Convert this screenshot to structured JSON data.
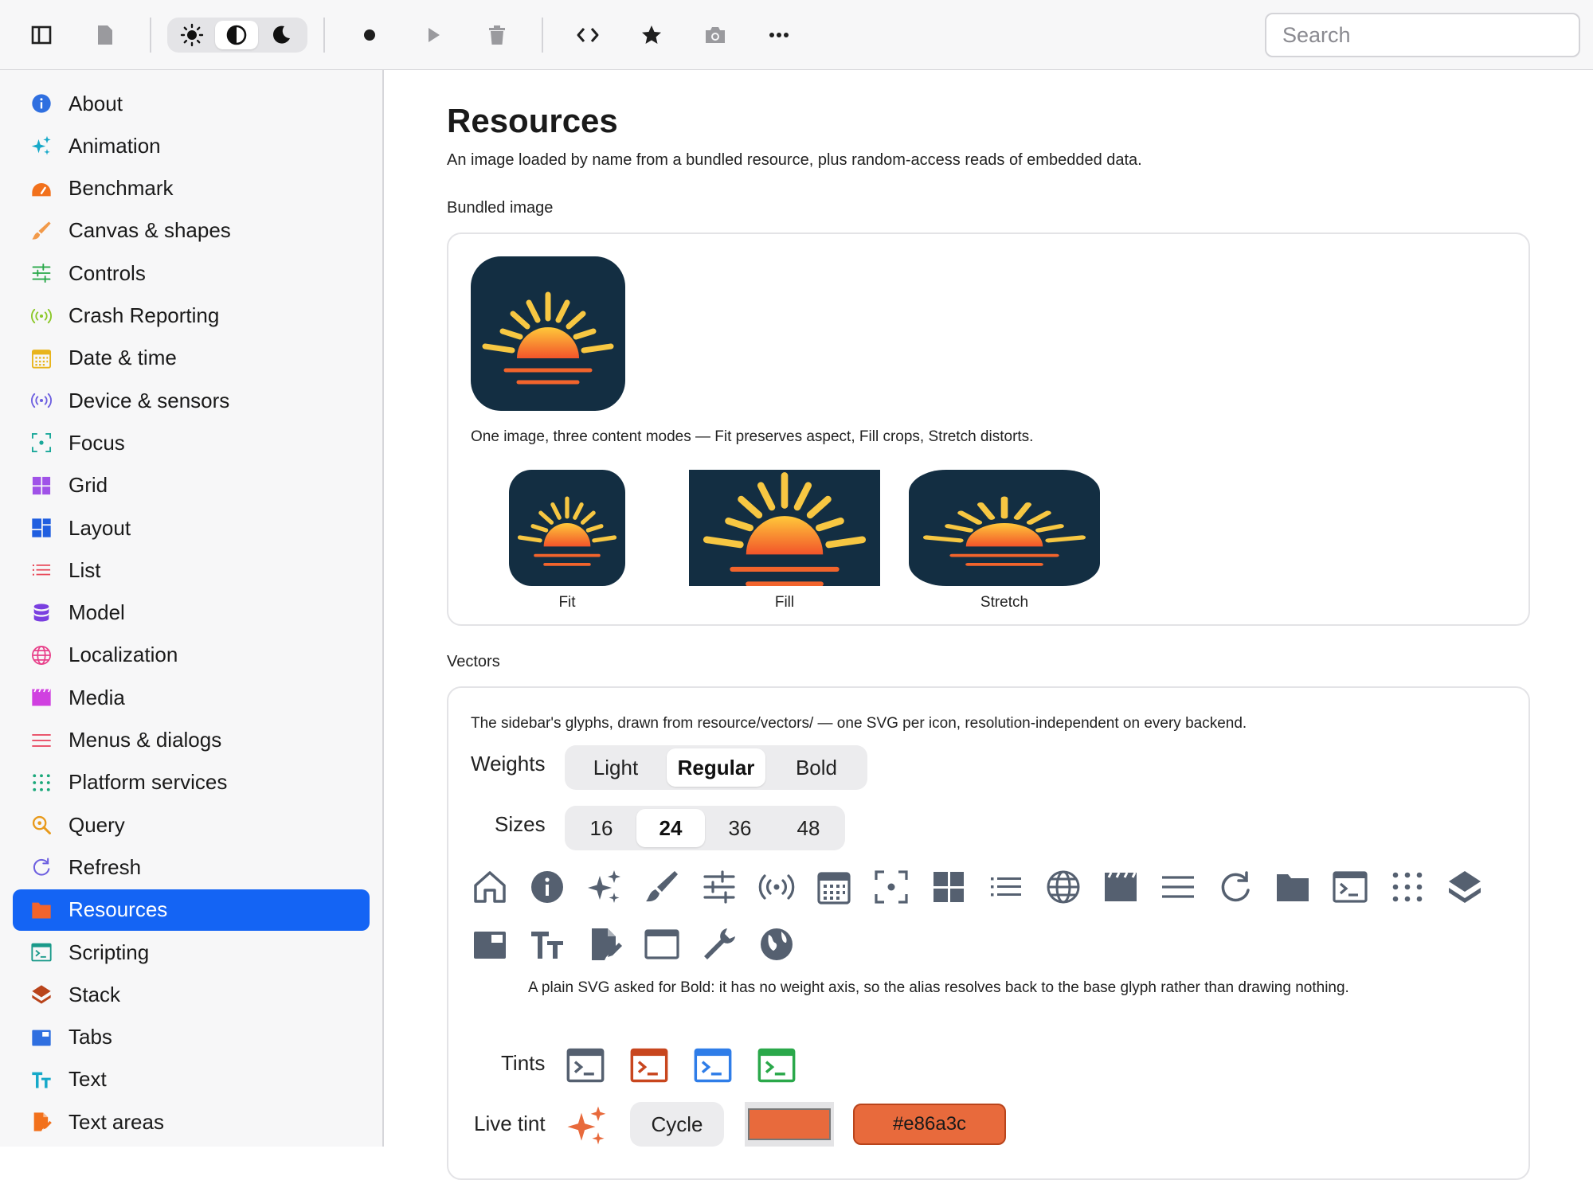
{
  "toolbar": {
    "search_placeholder": "Search",
    "icons": [
      "sidebar-toggle-icon",
      "document-icon",
      "sun-icon",
      "contrast-icon",
      "moon-icon",
      "record-icon",
      "play-icon",
      "trash-icon",
      "code-icon",
      "star-icon",
      "camera-icon",
      "more-icon"
    ]
  },
  "sidebar": {
    "items": [
      {
        "label": "About",
        "icon": "info-icon",
        "color": "#2f6fe0"
      },
      {
        "label": "Animation",
        "icon": "sparkles-icon",
        "color": "#16a9c9"
      },
      {
        "label": "Benchmark",
        "icon": "gauge-icon",
        "color": "#f2711c"
      },
      {
        "label": "Canvas & shapes",
        "icon": "brush-icon",
        "color": "#f29a4a"
      },
      {
        "label": "Controls",
        "icon": "sliders-icon",
        "color": "#2aa84a"
      },
      {
        "label": "Crash Reporting",
        "icon": "broadcast-icon",
        "color": "#8cc82a"
      },
      {
        "label": "Date & time",
        "icon": "calendar-icon",
        "color": "#e8b41c"
      },
      {
        "label": "Device & sensors",
        "icon": "sensor-icon",
        "color": "#6d5fe0"
      },
      {
        "label": "Focus",
        "icon": "focus-icon",
        "color": "#1aa89a"
      },
      {
        "label": "Grid",
        "icon": "grid-icon",
        "color": "#a052e8"
      },
      {
        "label": "Layout",
        "icon": "layout-icon",
        "color": "#1f5ee0"
      },
      {
        "label": "List",
        "icon": "list-icon",
        "color": "#e84a5a"
      },
      {
        "label": "Model",
        "icon": "database-icon",
        "color": "#7a3fe0"
      },
      {
        "label": "Localization",
        "icon": "globe-icon",
        "color": "#e8408a"
      },
      {
        "label": "Media",
        "icon": "clapper-icon",
        "color": "#d040e0"
      },
      {
        "label": "Menus & dialogs",
        "icon": "menu-icon",
        "color": "#e8405a"
      },
      {
        "label": "Platform services",
        "icon": "dots-grid-icon",
        "color": "#1aa87a"
      },
      {
        "label": "Query",
        "icon": "search-icon",
        "color": "#e89a1c"
      },
      {
        "label": "Refresh",
        "icon": "refresh-icon",
        "color": "#6d5fe0"
      },
      {
        "label": "Resources",
        "icon": "folder-icon",
        "color": "#f2642c",
        "active": true
      },
      {
        "label": "Scripting",
        "icon": "terminal-icon",
        "color": "#1a9a8a"
      },
      {
        "label": "Stack",
        "icon": "layers-icon",
        "color": "#b9441b"
      },
      {
        "label": "Tabs",
        "icon": "tabs-icon",
        "color": "#2f6fe0"
      },
      {
        "label": "Text",
        "icon": "text-icon",
        "color": "#16a9c9"
      },
      {
        "label": "Text areas",
        "icon": "document-edit-icon",
        "color": "#f2711c"
      }
    ]
  },
  "main": {
    "title": "Resources",
    "subtitle": "An image loaded by name from a bundled resource, plus random-access reads of embedded data.",
    "bundled": {
      "heading": "Bundled image",
      "caption": "One image, three content modes — Fit preserves aspect, Fill crops, Stretch distorts.",
      "modes": [
        "Fit",
        "Fill",
        "Stretch"
      ]
    },
    "vectors": {
      "heading": "Vectors",
      "caption": "The sidebar's glyphs, drawn from resource/vectors/ — one SVG per icon, resolution-independent on every backend.",
      "weights_label": "Weights",
      "weights": [
        "Light",
        "Regular",
        "Bold"
      ],
      "weight_selected": "Regular",
      "sizes_label": "Sizes",
      "sizes": [
        "16",
        "24",
        "36",
        "48"
      ],
      "size_selected": "24",
      "note": "A plain SVG asked for Bold: it has no weight axis, so the alias resolves back to the base glyph rather than drawing nothing.",
      "tints_label": "Tints",
      "tint_colors": [
        "#556070",
        "#c8461e",
        "#2f7de8",
        "#2aa84a"
      ],
      "live_tint_label": "Live tint",
      "cycle_label": "Cycle",
      "live_color": "#e86a3c",
      "live_hex": "#e86a3c",
      "glyphs": [
        "home-icon",
        "info-icon",
        "sparkles-icon",
        "brush-icon",
        "sliders-icon",
        "broadcast-icon",
        "calendar-icon",
        "focus-icon",
        "grid-icon",
        "list-icon",
        "globe-icon",
        "clapper-icon",
        "menu-icon",
        "refresh-icon",
        "folder-icon",
        "terminal-icon",
        "dots-grid-icon",
        "layers-icon",
        "tabs-icon",
        "text-icon",
        "document-edit-icon",
        "window-icon",
        "wrench-icon",
        "globe-filled-icon"
      ]
    }
  }
}
